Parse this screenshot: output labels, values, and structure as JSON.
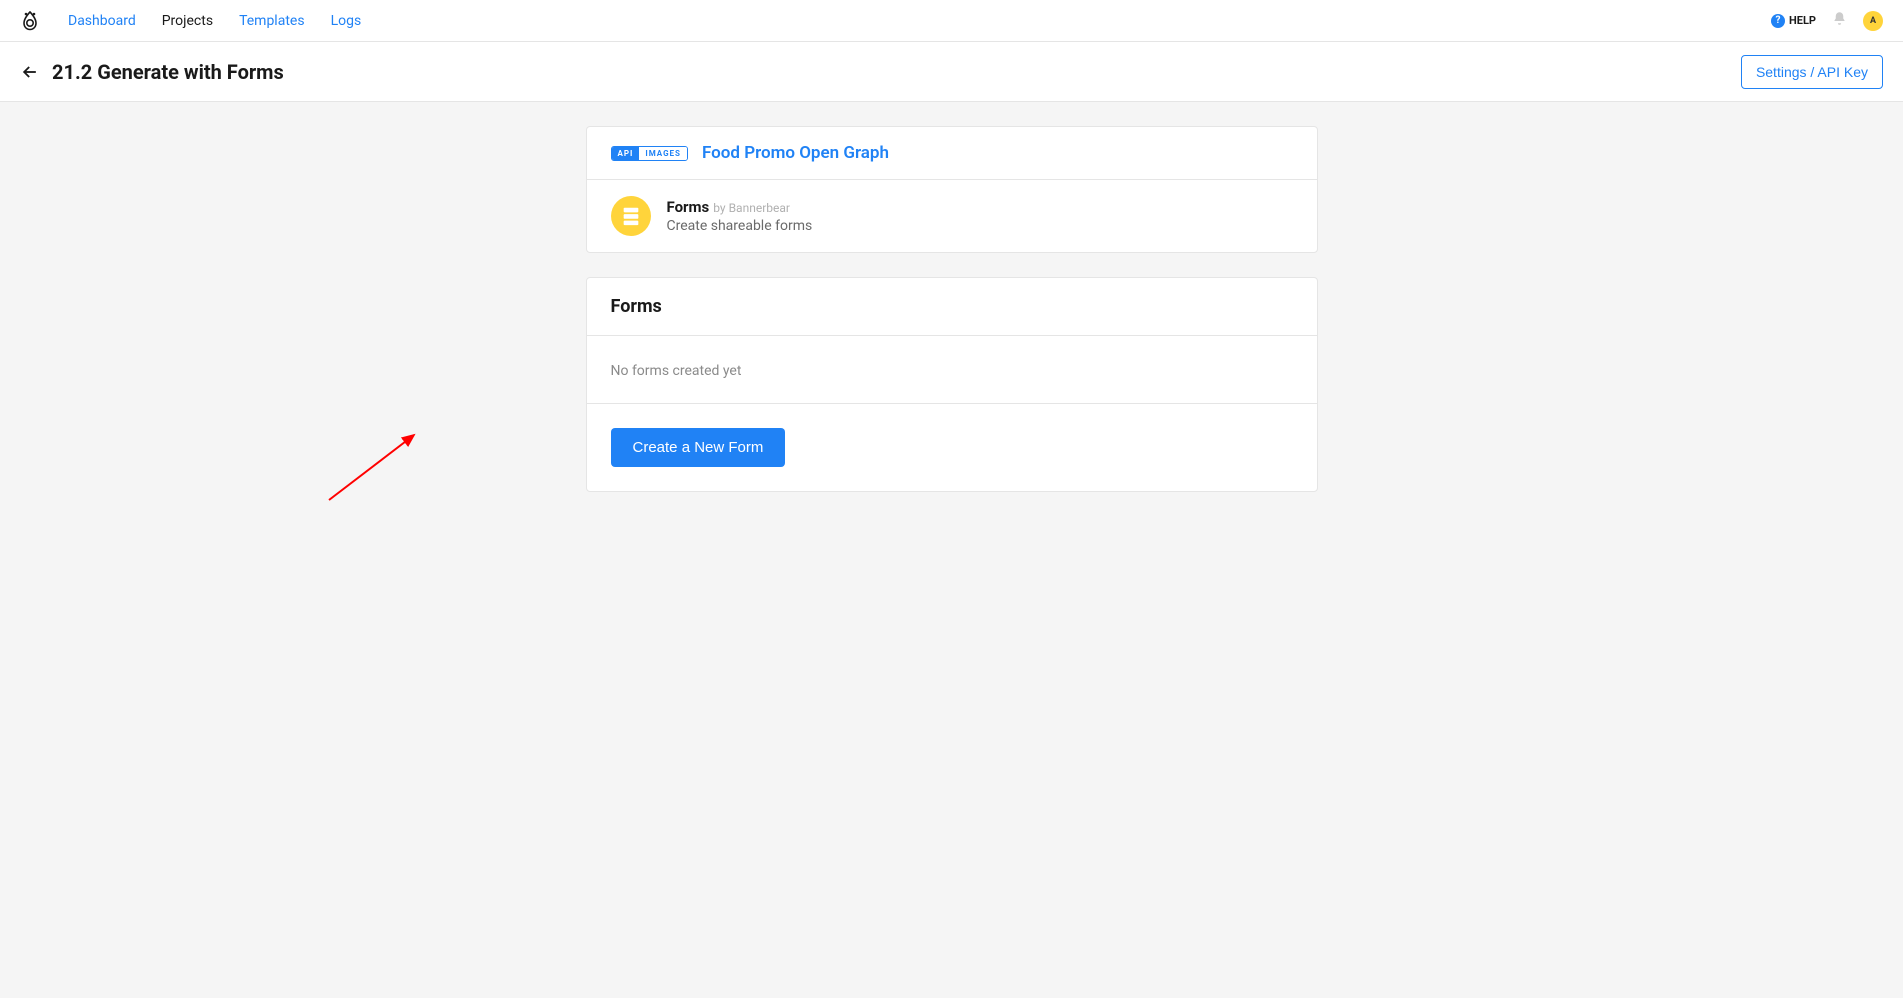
{
  "nav": {
    "items": [
      {
        "label": "Dashboard",
        "active": false
      },
      {
        "label": "Projects",
        "active": true
      },
      {
        "label": "Templates",
        "active": false
      },
      {
        "label": "Logs",
        "active": false
      }
    ],
    "help_label": "HELP",
    "avatar_initial": "A"
  },
  "subheader": {
    "title": "21.2 Generate with Forms",
    "settings_label": "Settings / API Key"
  },
  "template_card": {
    "badge_left": "API",
    "badge_right": "IMAGES",
    "template_name": "Food Promo Open Graph",
    "integration_name": "Forms",
    "integration_by": "by Bannerbear",
    "integration_desc": "Create shareable forms"
  },
  "forms_card": {
    "title": "Forms",
    "empty_message": "No forms created yet",
    "create_button": "Create a New Form"
  }
}
